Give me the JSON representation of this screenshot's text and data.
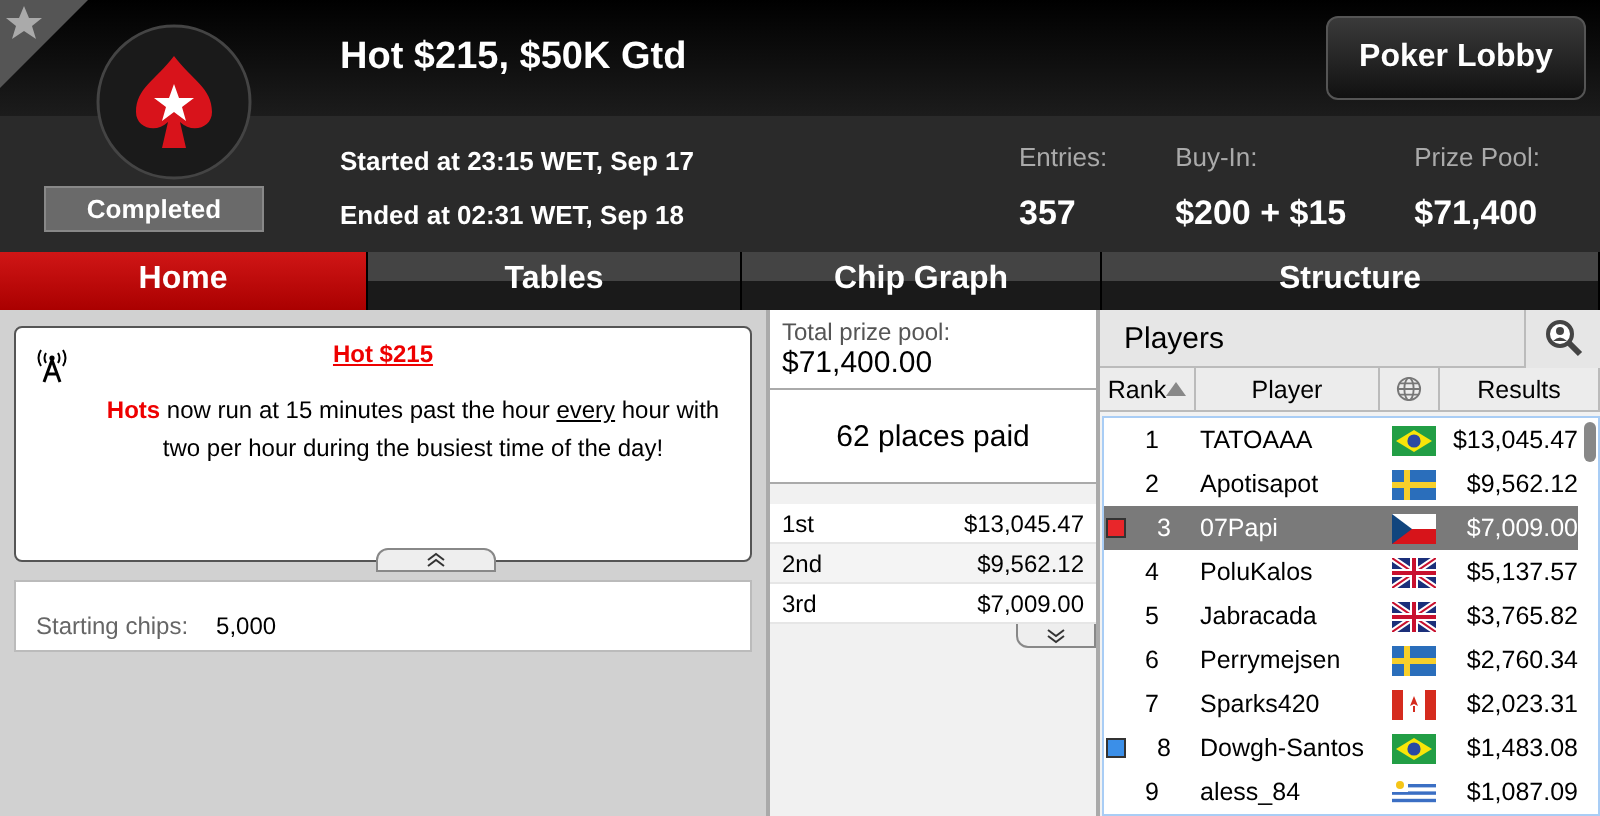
{
  "header": {
    "title": "Hot $215, $50K Gtd",
    "status": "Completed",
    "started": "Started at 23:15 WET, Sep 17",
    "ended": "Ended at 02:31 WET, Sep 18",
    "lobby_button": "Poker Lobby",
    "stats": [
      {
        "label": "Entries:",
        "value": "357"
      },
      {
        "label": "Buy-In:",
        "value": "$200 + $15"
      },
      {
        "label": "Prize Pool:",
        "value": "$71,400"
      }
    ]
  },
  "tabs": [
    {
      "label": "Home",
      "selected": true
    },
    {
      "label": "Tables",
      "selected": false
    },
    {
      "label": "Chip Graph",
      "selected": false
    },
    {
      "label": "Structure",
      "selected": false
    }
  ],
  "announcement": {
    "title": "Hot $215",
    "text": "**Hots** now run at 15 minutes past the hour *every* hour with two per hour during the busiest time of the day!"
  },
  "info": {
    "label": "Starting chips:",
    "value": "5,000"
  },
  "prizes": {
    "total_label": "Total prize pool:",
    "total": "$71,400.00",
    "places": "62 places paid",
    "rows": [
      {
        "place": "1st",
        "amount": "$13,045.47"
      },
      {
        "place": "2nd",
        "amount": "$9,562.12"
      },
      {
        "place": "3rd",
        "amount": "$7,009.00"
      }
    ]
  },
  "players": {
    "title": "Players",
    "columns": [
      "Rank",
      "Player",
      "Results"
    ],
    "rows": [
      {
        "rank": "1",
        "name": "TATOAAA",
        "kind": "brazil",
        "result": "$13,045.47",
        "selected": false
      },
      {
        "rank": "2",
        "name": "Apotisapot",
        "kind": "sweden",
        "result": "$9,562.12",
        "selected": false
      },
      {
        "rank": "3",
        "name": "07Papi",
        "kind": "czech",
        "result": "$7,009.00",
        "selected": true,
        "color": "#e8262a"
      },
      {
        "rank": "4",
        "name": "PoluKalos",
        "kind": "uk",
        "result": "$5,137.57",
        "selected": false
      },
      {
        "rank": "5",
        "name": "Jabracada",
        "kind": "uk",
        "result": "$3,765.82",
        "selected": false
      },
      {
        "rank": "6",
        "name": "Perrymejsen",
        "kind": "sweden",
        "result": "$2,760.34",
        "selected": false
      },
      {
        "rank": "7",
        "name": "Sparks420",
        "kind": "canada",
        "result": "$2,023.31",
        "selected": false
      },
      {
        "rank": "8",
        "name": "Dowgh-Santos",
        "kind": "brazil",
        "result": "$1,483.08",
        "selected": false,
        "color": "#3b8fe8"
      },
      {
        "rank": "9",
        "name": "aless_84",
        "kind": "uruguay",
        "result": "$1,087.09",
        "selected": false
      }
    ]
  }
}
